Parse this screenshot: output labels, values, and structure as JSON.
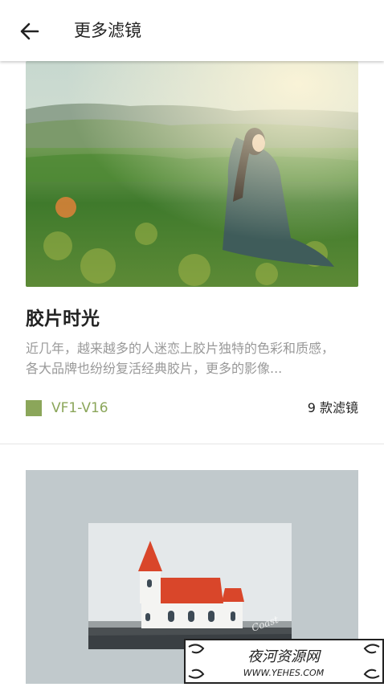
{
  "header": {
    "title": "更多滤镜"
  },
  "filters": [
    {
      "title": "胶片时光",
      "description": "近几年，越来越多的人迷恋上胶片独特的色彩和质感，各大品牌也纷纷复活经典胶片，更多的影像...",
      "code": "VF1-V16",
      "count": "9 款滤镜",
      "accent_color": "#8ba65a"
    }
  ],
  "watermark": {
    "text_main": "夜河资源网",
    "text_url": "WWW.YEHES.COM"
  }
}
